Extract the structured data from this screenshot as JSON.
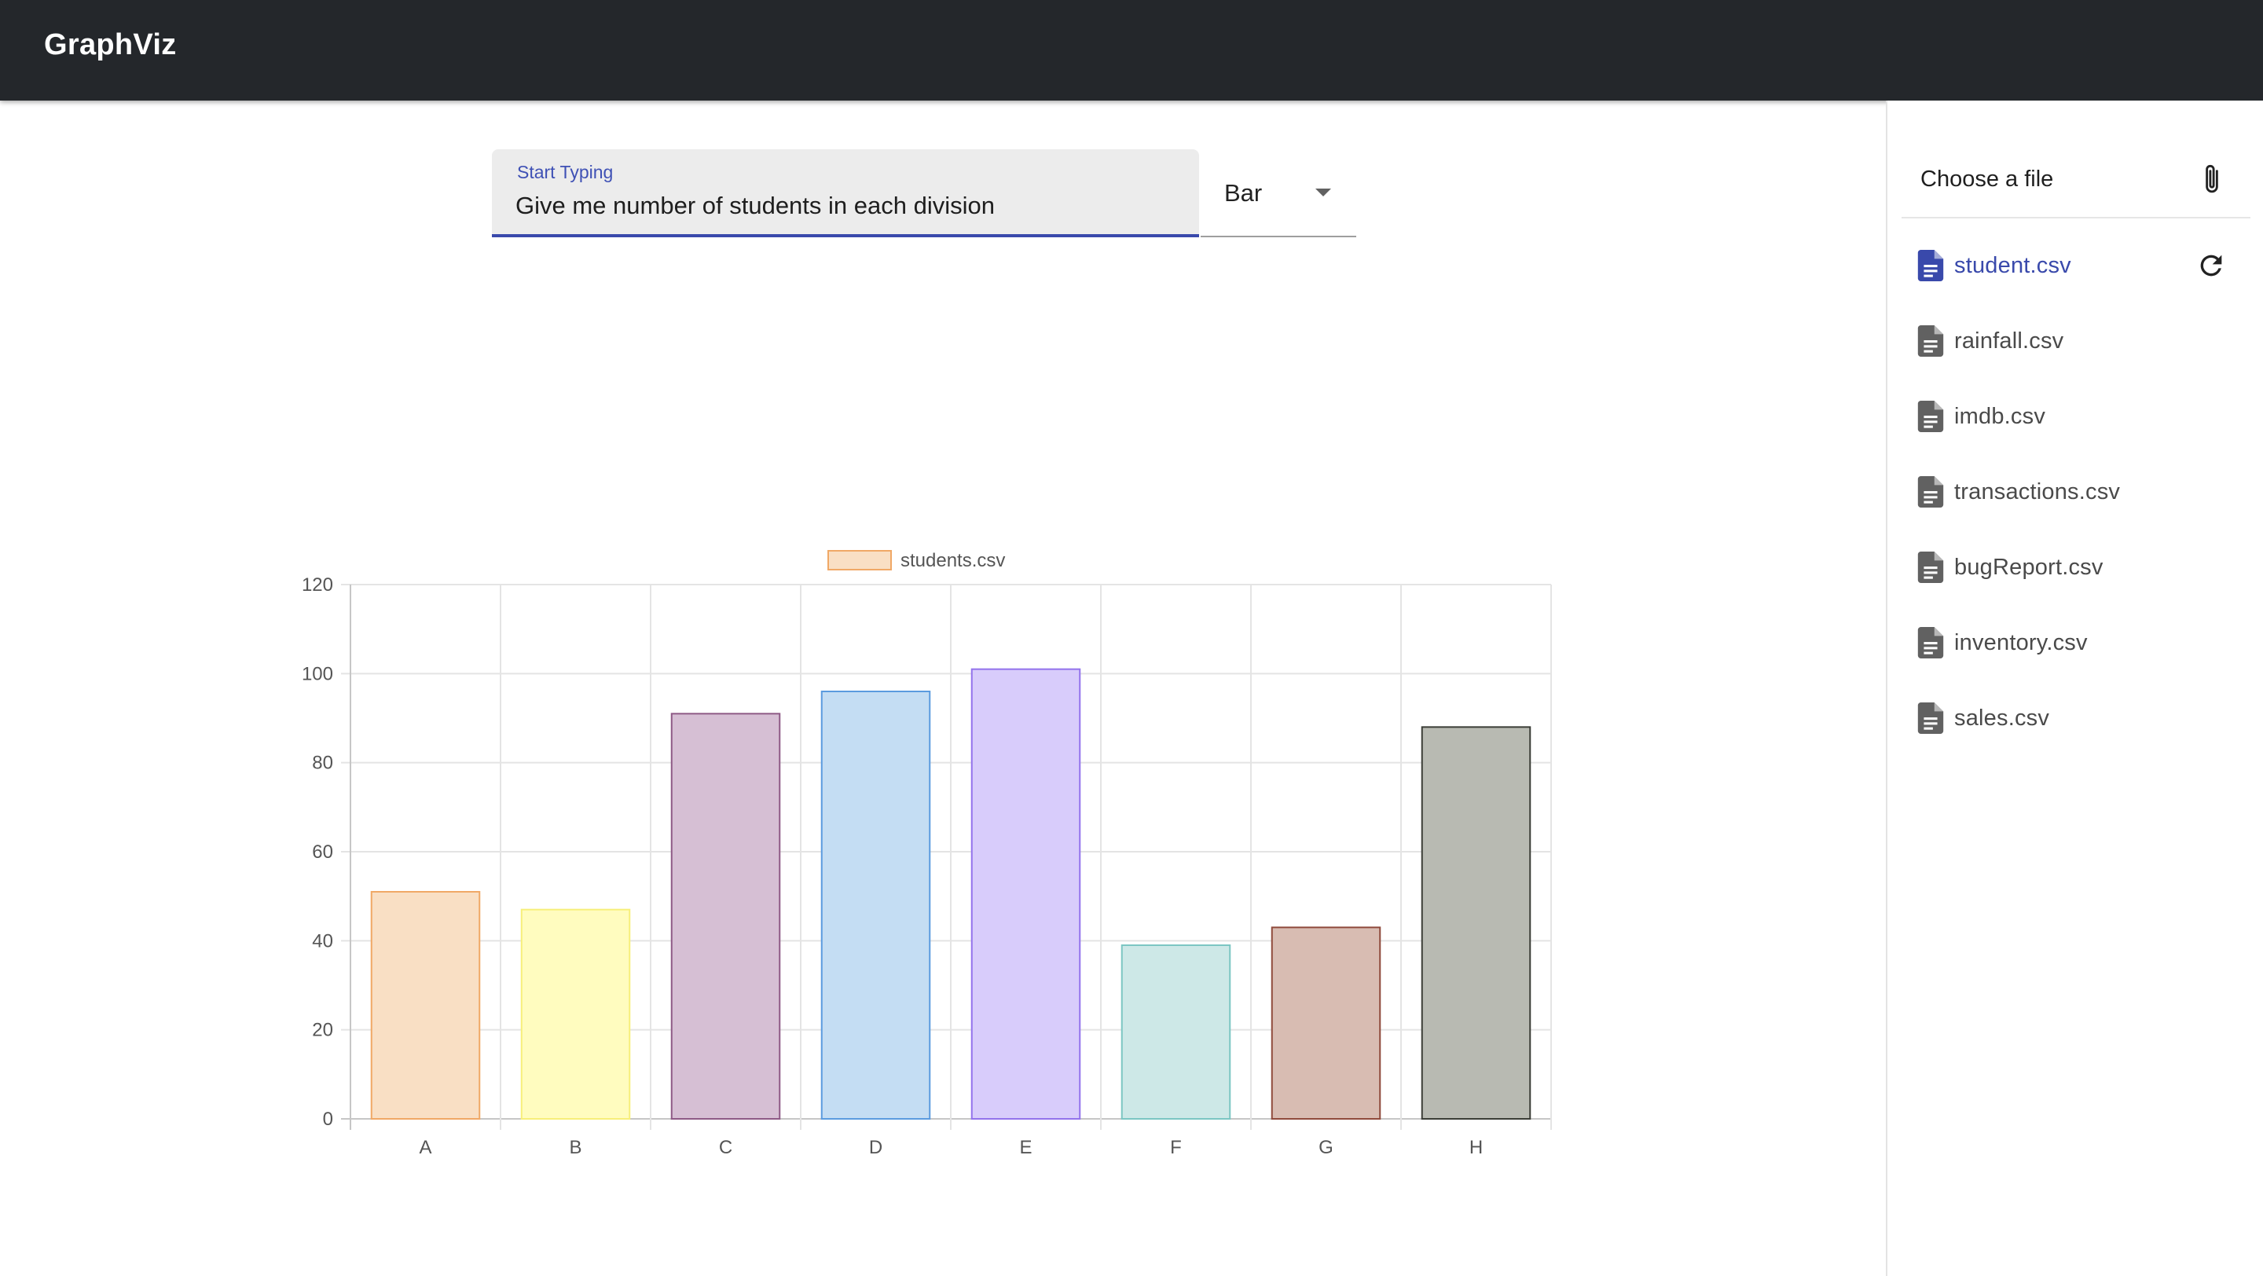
{
  "app": {
    "title": "GraphViz"
  },
  "query": {
    "label": "Start Typing",
    "value": "Give me number of students in each division"
  },
  "chart_type_select": {
    "selected": "Bar"
  },
  "sidebar": {
    "chooser_label": "Choose a file",
    "files": [
      {
        "name": "student.csv",
        "active": true
      },
      {
        "name": "rainfall.csv",
        "active": false
      },
      {
        "name": "imdb.csv",
        "active": false
      },
      {
        "name": "transactions.csv",
        "active": false
      },
      {
        "name": "bugReport.csv",
        "active": false
      },
      {
        "name": "inventory.csv",
        "active": false
      },
      {
        "name": "sales.csv",
        "active": false
      }
    ]
  },
  "colors": {
    "accent": "#3949ab",
    "appbar": "#24272b",
    "file_icon": "#616161"
  },
  "icons": {
    "chooser": "paperclip-icon",
    "file": "document-icon",
    "refresh": "refresh-icon",
    "dropdown": "caret-down-icon"
  },
  "chart_data": {
    "type": "bar",
    "categories": [
      "A",
      "B",
      "C",
      "D",
      "E",
      "F",
      "G",
      "H"
    ],
    "series": [
      {
        "name": "students.csv",
        "values": [
          51,
          47,
          91,
          96,
          101,
          39,
          43,
          88
        ]
      }
    ],
    "ylim": [
      0,
      120
    ],
    "yticks": [
      0,
      20,
      40,
      60,
      80,
      100,
      120
    ],
    "legend": "top-center",
    "grid": true,
    "bar_fills": [
      "#f9dfc4",
      "#fffcbf",
      "#d6bfd4",
      "#c4ddf3",
      "#d8ccfb",
      "#cde8e7",
      "#d8bcb2",
      "#b8bab2"
    ],
    "bar_strokes": [
      "#f0a866",
      "#f7ef7a",
      "#8e5a86",
      "#5b9bdf",
      "#9373ec",
      "#7cc6c3",
      "#8f4a3c",
      "#3b3e37"
    ],
    "legend_fill": "#f9dfc4",
    "legend_stroke": "#f0a866"
  }
}
